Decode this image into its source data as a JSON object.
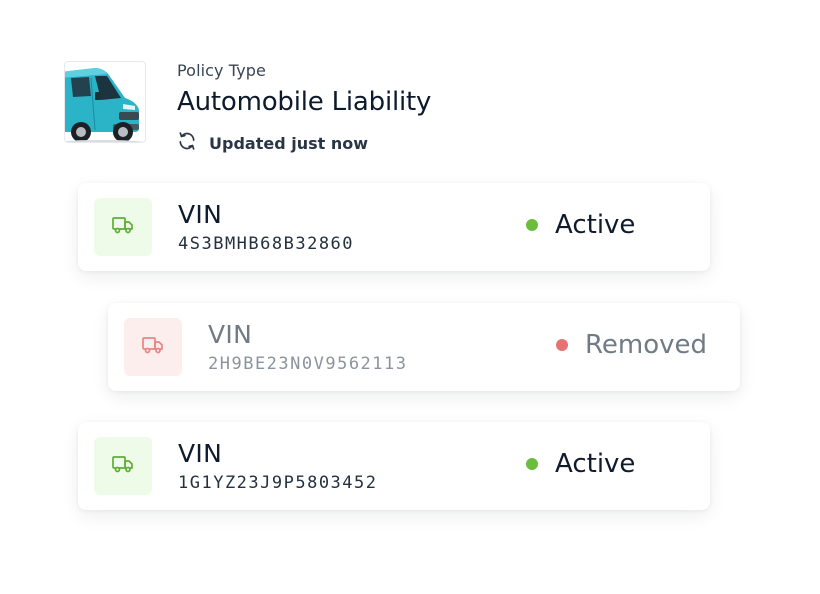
{
  "policy": {
    "type_label": "Policy Type",
    "type_value": "Automobile Liability",
    "updated_text": "Updated just now",
    "thumbnail_icon": "van-photo",
    "refresh_icon": "refresh-icon"
  },
  "vehicles": [
    {
      "label": "VIN",
      "vin": "4S3BMHB68B32860",
      "status": "Active",
      "icon": "truck-icon"
    },
    {
      "label": "VIN",
      "vin": "2H9BE23N0V9562113",
      "status": "Removed",
      "icon": "truck-icon"
    },
    {
      "label": "VIN",
      "vin": "1G1YZ23J9P5803452",
      "status": "Active",
      "icon": "truck-icon"
    }
  ],
  "colors": {
    "active": "#6cbd3e",
    "removed": "#e57373",
    "active_icon_bg": "#effbe9",
    "removed_icon_bg": "#fdeeee",
    "text_primary": "#0f1b2d",
    "text_muted": "#707b85"
  }
}
